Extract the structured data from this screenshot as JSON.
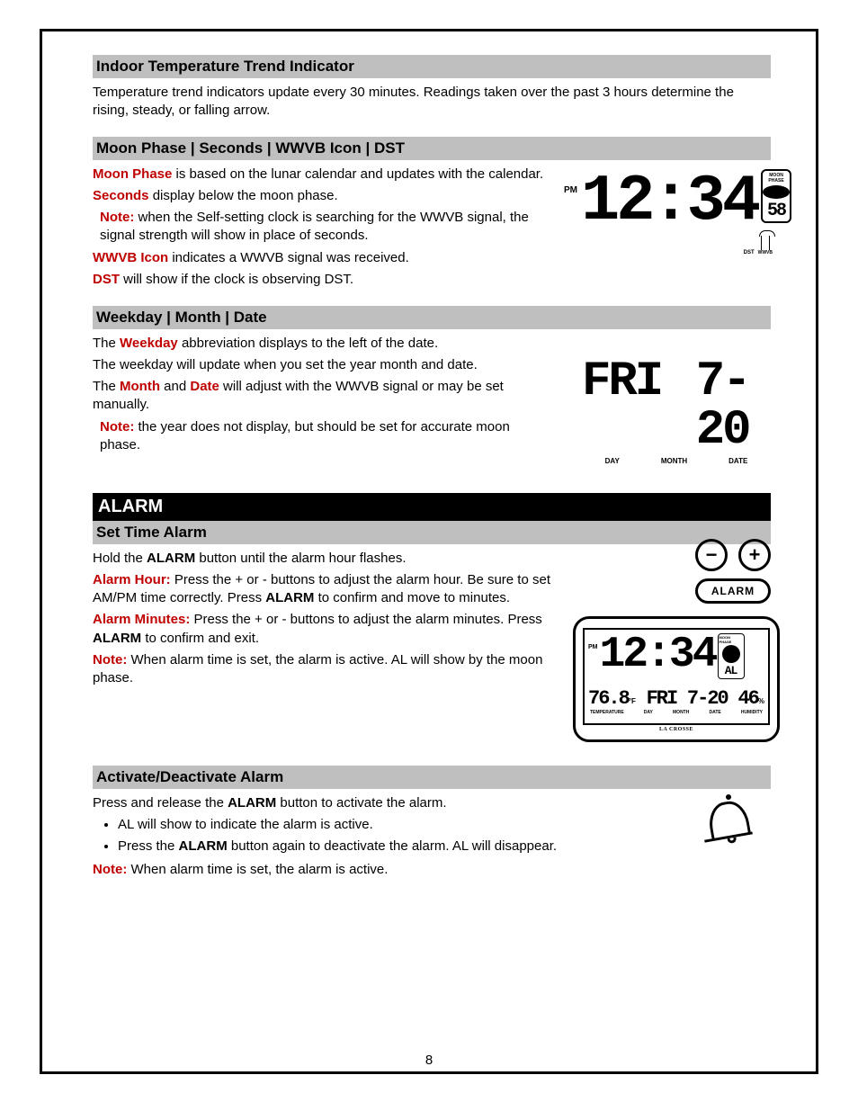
{
  "page_number": "8",
  "s_temp": {
    "heading": "Indoor Temperature Trend Indicator",
    "body": "Temperature trend indicators update every 30 minutes. Readings taken over the past 3 hours determine the rising, steady, or falling arrow."
  },
  "s_moon": {
    "heading": "Moon Phase | Seconds | WWVB Icon | DST",
    "l1_a": "Moon Phase",
    "l1_b": " is based on the lunar calendar and updates with the calendar.",
    "l2_a": "Seconds",
    "l2_b": " display below the moon phase.",
    "note_label": "Note:",
    "note_body": " when the Self-setting clock is searching for the WWVB signal, the signal strength will show in place of seconds.",
    "l3_a": "WWVB Icon",
    "l3_b": " indicates a WWVB signal was received.",
    "l4_a": "DST",
    "l4_b": " will show if the clock is observing DST.",
    "lcd": {
      "pm": "PM",
      "time": "12:34",
      "moon_label": "MOON PHASE",
      "seconds": "58",
      "dst": "DST",
      "wwvb": "WWVB"
    }
  },
  "s_cal": {
    "heading": "Weekday | Month | Date",
    "l1_pre": "The ",
    "l1_bold": "Weekday",
    "l1_post": " abbreviation displays to the left of the date.",
    "l2": "The weekday will update when you set the year month and date.",
    "l3_pre": "The ",
    "l3_b1": "Month",
    "l3_mid": " and ",
    "l3_b2": "Date",
    "l3_post": " will adjust with the WWVB signal or may be set manually.",
    "note_label": "Note:",
    "note_body": " the year does not display, but should be set for accurate moon phase.",
    "lcd": {
      "day": "FRI",
      "md": "7-20",
      "lbl_day": "DAY",
      "lbl_month": "MONTH",
      "lbl_date": "DATE"
    }
  },
  "bar_alarm": "ALARM",
  "s_set": {
    "heading": "Set Time Alarm",
    "l1_pre": "Hold the ",
    "l1_bold": "ALARM",
    "l1_post": " button until the alarm hour flashes.",
    "l2_b1": "Alarm Hour:",
    "l2_mid": " Press the + or - buttons to adjust the alarm hour. Be sure to set AM/PM time correctly. Press ",
    "l2_b2": "ALARM",
    "l2_post": " to confirm and move to minutes.",
    "l3_b1": "Alarm Minutes:",
    "l3_mid": " Press the + or - buttons to adjust the alarm minutes. Press ",
    "l3_b2": "ALARM",
    "l3_post": " to confirm and exit.",
    "note_label": "Note:",
    "note_body": " When alarm time is set, the alarm is active. AL will show by the moon phase.",
    "buttons": {
      "minus": "−",
      "plus": "+",
      "alarm": "ALARM"
    },
    "device": {
      "pm": "PM",
      "time": "12:34",
      "moon": "MOON PHASE",
      "al": "AL",
      "temp": "76.8",
      "tf": "°F",
      "day": "FRI",
      "md": "7-20",
      "hum": "46",
      "pct": "%",
      "lbl_temp": "TEMPERATURE",
      "lbl_day": "DAY",
      "lbl_month": "MONTH",
      "lbl_date": "DATE",
      "lbl_hum": "HUMIDITY",
      "brand": "LA CROSSE"
    }
  },
  "s_act": {
    "heading": "Activate/Deactivate Alarm",
    "l1_pre": "Press and release the ",
    "l1_bold": "ALARM",
    "l1_post": " button to activate the alarm.",
    "bullets": [
      "AL will show to indicate the alarm is active.",
      {
        "pre": "Press the ",
        "bold": "ALARM",
        "post": " button again to deactivate the alarm. AL will disappear."
      }
    ],
    "note_label": "Note:",
    "note_body": " When alarm time is set, the alarm is active."
  }
}
